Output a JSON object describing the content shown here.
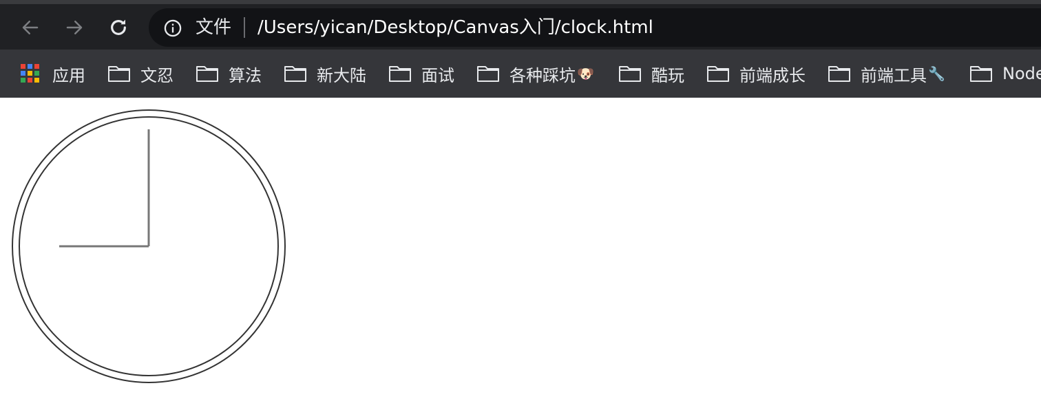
{
  "toolbar": {
    "back_icon": "arrow-back-icon",
    "forward_icon": "arrow-forward-icon",
    "reload_icon": "reload-icon"
  },
  "omnibox": {
    "info_icon": "info-circle-icon",
    "security_label": "文件",
    "url": "/Users/yican/Desktop/Canvas入门/clock.html"
  },
  "bookmarks": {
    "apps_label": "应用",
    "folders": [
      {
        "label": "文忍",
        "emoji": ""
      },
      {
        "label": "算法",
        "emoji": ""
      },
      {
        "label": "新大陆",
        "emoji": ""
      },
      {
        "label": "面试",
        "emoji": ""
      },
      {
        "label": "各种踩坑",
        "emoji": "🐶"
      },
      {
        "label": "酷玩",
        "emoji": ""
      },
      {
        "label": "前端成长",
        "emoji": ""
      },
      {
        "label": "前端工具",
        "emoji": "🔧"
      },
      {
        "label": "Node",
        "emoji": ""
      }
    ]
  },
  "clock": {
    "hours": 9,
    "minutes": 0,
    "seconds": 0
  },
  "colors": {
    "titlebar_bg": "#202124",
    "omnibox_bg": "#121316",
    "bookmarks_bg": "#35363a",
    "text_light": "#e8eaed",
    "clock_stroke": "#333333",
    "hand_color": "#777777",
    "apps_grid": [
      "#ea4335",
      "#4285f4",
      "#ea4335",
      "#4285f4",
      "#fbbc05",
      "#34a853",
      "#34a853",
      "#ea4335",
      "#fbbc05"
    ]
  }
}
